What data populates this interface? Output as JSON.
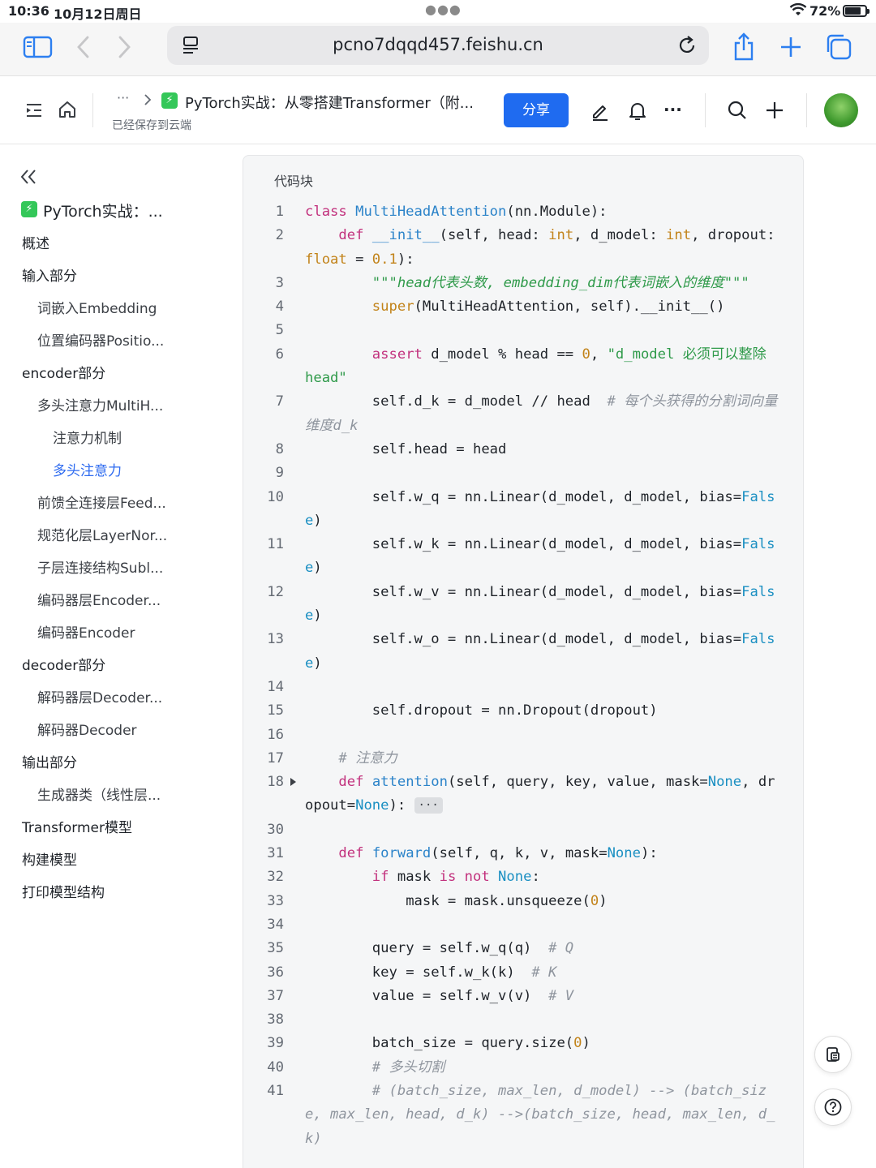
{
  "status_bar": {
    "time": "10:36",
    "date": "10月12日周日",
    "battery": "72%",
    "battery_level": 0.72
  },
  "browser": {
    "url": "pcno7dqqd457.feishu.cn"
  },
  "header": {
    "breadcrumb_more": "···",
    "doc_title": "PyTorch实战：从零搭建Transformer（附...",
    "saved_status": "已经保存到云端",
    "share_label": "分享",
    "more_label": "···"
  },
  "sidebar": {
    "items": [
      {
        "label": "PyTorch实战：...",
        "level": 0
      },
      {
        "label": "概述",
        "level": 1
      },
      {
        "label": "输入部分",
        "level": 1
      },
      {
        "label": "词嵌入Embedding",
        "level": 2
      },
      {
        "label": "位置编码器Positio...",
        "level": 2
      },
      {
        "label": "encoder部分",
        "level": 1
      },
      {
        "label": "多头注意力MultiH...",
        "level": 2
      },
      {
        "label": "注意力机制",
        "level": 3
      },
      {
        "label": "多头注意力",
        "level": 3,
        "active": true
      },
      {
        "label": "前馈全连接层Feed...",
        "level": 2
      },
      {
        "label": "规范化层LayerNor...",
        "level": 2
      },
      {
        "label": "子层连接结构Subl...",
        "level": 2
      },
      {
        "label": "编码器层Encoder...",
        "level": 2
      },
      {
        "label": "编码器Encoder",
        "level": 2
      },
      {
        "label": "decoder部分",
        "level": 1
      },
      {
        "label": "解码器层Decoder...",
        "level": 2
      },
      {
        "label": "解码器Decoder",
        "level": 2
      },
      {
        "label": "输出部分",
        "level": 1
      },
      {
        "label": "生成器类（线性层...",
        "level": 2
      },
      {
        "label": "Transformer模型",
        "level": 1
      },
      {
        "label": "构建模型",
        "level": 1
      },
      {
        "label": "打印模型结构",
        "level": 1
      }
    ]
  },
  "code_block": {
    "title": "代码块",
    "colors": {
      "keyword": "#c2317d",
      "function": "#2b83c9",
      "number": "#c2831a",
      "builtin": "#c2831a",
      "string": "#2f9a4a",
      "comment": "#8f959e",
      "constant": "#1a8fc2"
    },
    "lines": [
      {
        "n": "1",
        "tokens": [
          [
            "class ",
            "keyword"
          ],
          [
            "MultiHeadAttention",
            "function"
          ],
          [
            "(nn.Module):",
            ""
          ]
        ]
      },
      {
        "n": "2",
        "tokens": [
          [
            "    ",
            ""
          ],
          [
            "def ",
            "keyword"
          ],
          [
            "__init__",
            "function"
          ],
          [
            "(self, head: ",
            ""
          ],
          [
            "int",
            "builtin"
          ],
          [
            ", d_model: ",
            ""
          ],
          [
            "int",
            "builtin"
          ],
          [
            ", dropout: ",
            ""
          ],
          [
            "float",
            "builtin"
          ],
          [
            " = ",
            ""
          ],
          [
            "0.1",
            "number"
          ],
          [
            "):",
            ""
          ]
        ]
      },
      {
        "n": "3",
        "tokens": [
          [
            "        ",
            ""
          ],
          [
            "\"\"\"head代表头数, embedding_dim代表词嵌入的维度\"\"\"",
            "string-italic"
          ]
        ]
      },
      {
        "n": "4",
        "tokens": [
          [
            "        ",
            ""
          ],
          [
            "super",
            "builtin"
          ],
          [
            "(MultiHeadAttention, self).__init__()",
            ""
          ]
        ]
      },
      {
        "n": "5",
        "tokens": []
      },
      {
        "n": "6",
        "tokens": [
          [
            "        ",
            ""
          ],
          [
            "assert",
            "keyword"
          ],
          [
            " d_model % head == ",
            ""
          ],
          [
            "0",
            "number"
          ],
          [
            ", ",
            ""
          ],
          [
            "\"d_model 必须可以整除 head\"",
            "string"
          ]
        ]
      },
      {
        "n": "7",
        "tokens": [
          [
            "        self.d_k = d_model // head  ",
            ""
          ],
          [
            "# 每个头获得的分割词向量维度d_k",
            "comment"
          ]
        ]
      },
      {
        "n": "8",
        "tokens": [
          [
            "        self.head = head",
            ""
          ]
        ]
      },
      {
        "n": "9",
        "tokens": []
      },
      {
        "n": "10",
        "tokens": [
          [
            "        self.w_q = nn.Linear(d_model, d_model, bias=",
            ""
          ],
          [
            "False",
            "constant"
          ],
          [
            ")",
            ""
          ]
        ]
      },
      {
        "n": "11",
        "tokens": [
          [
            "        self.w_k = nn.Linear(d_model, d_model, bias=",
            ""
          ],
          [
            "False",
            "constant"
          ],
          [
            ")",
            ""
          ]
        ]
      },
      {
        "n": "12",
        "tokens": [
          [
            "        self.w_v = nn.Linear(d_model, d_model, bias=",
            ""
          ],
          [
            "False",
            "constant"
          ],
          [
            ")",
            ""
          ]
        ]
      },
      {
        "n": "13",
        "tokens": [
          [
            "        self.w_o = nn.Linear(d_model, d_model, bias=",
            ""
          ],
          [
            "False",
            "constant"
          ],
          [
            ")",
            ""
          ]
        ]
      },
      {
        "n": "14",
        "tokens": []
      },
      {
        "n": "15",
        "tokens": [
          [
            "        self.dropout = nn.Dropout(dropout)",
            ""
          ]
        ]
      },
      {
        "n": "16",
        "tokens": []
      },
      {
        "n": "17",
        "tokens": [
          [
            "    ",
            ""
          ],
          [
            "# 注意力",
            "comment"
          ]
        ]
      },
      {
        "n": "18",
        "collapsed": true,
        "tokens": [
          [
            "    ",
            ""
          ],
          [
            "def ",
            "keyword"
          ],
          [
            "attention",
            "function"
          ],
          [
            "(self, query, key, value, mask=",
            ""
          ],
          [
            "None",
            "constant"
          ],
          [
            ", dropout=",
            ""
          ],
          [
            "None",
            "constant"
          ],
          [
            "): ",
            ""
          ]
        ]
      },
      {
        "n": "30",
        "tokens": []
      },
      {
        "n": "31",
        "tokens": [
          [
            "    ",
            ""
          ],
          [
            "def ",
            "keyword"
          ],
          [
            "forward",
            "function"
          ],
          [
            "(self, q, k, v, mask=",
            ""
          ],
          [
            "None",
            "constant"
          ],
          [
            "):",
            ""
          ]
        ]
      },
      {
        "n": "32",
        "tokens": [
          [
            "        ",
            ""
          ],
          [
            "if",
            "keyword"
          ],
          [
            " mask ",
            ""
          ],
          [
            "is not",
            "keyword"
          ],
          [
            " ",
            ""
          ],
          [
            "None",
            "constant"
          ],
          [
            ":",
            ""
          ]
        ]
      },
      {
        "n": "33",
        "tokens": [
          [
            "            mask = mask.unsqueeze(",
            ""
          ],
          [
            "0",
            "number"
          ],
          [
            ")",
            ""
          ]
        ]
      },
      {
        "n": "34",
        "tokens": []
      },
      {
        "n": "35",
        "tokens": [
          [
            "        query = self.w_q(q)  ",
            ""
          ],
          [
            "# Q",
            "comment"
          ]
        ]
      },
      {
        "n": "36",
        "tokens": [
          [
            "        key = self.w_k(k)  ",
            ""
          ],
          [
            "# K",
            "comment"
          ]
        ]
      },
      {
        "n": "37",
        "tokens": [
          [
            "        value = self.w_v(v)  ",
            ""
          ],
          [
            "# V",
            "comment"
          ]
        ]
      },
      {
        "n": "38",
        "tokens": []
      },
      {
        "n": "39",
        "tokens": [
          [
            "        batch_size = query.size(",
            ""
          ],
          [
            "0",
            "number"
          ],
          [
            ")",
            ""
          ]
        ]
      },
      {
        "n": "40",
        "tokens": [
          [
            "        ",
            ""
          ],
          [
            "# 多头切割",
            "comment"
          ]
        ]
      },
      {
        "n": "41",
        "tokens": [
          [
            "        ",
            ""
          ],
          [
            "# (batch_size, max_len, d_model) --> (batch_size, max_len, head, d_k) -->(batch_size, head, max_len, d_k)",
            "comment"
          ]
        ]
      }
    ]
  },
  "icons": [
    "sidebar-toggle-icon",
    "back-icon",
    "forward-icon",
    "reader-icon",
    "reload-icon",
    "share-icon",
    "new-tab-icon",
    "tabs-icon",
    "outline-icon",
    "home-icon",
    "chevron-right-icon",
    "edit-icon",
    "bell-icon",
    "more-icon",
    "search-icon",
    "plus-icon",
    "collapse-double-left-icon",
    "comment-icon",
    "help-icon"
  ]
}
